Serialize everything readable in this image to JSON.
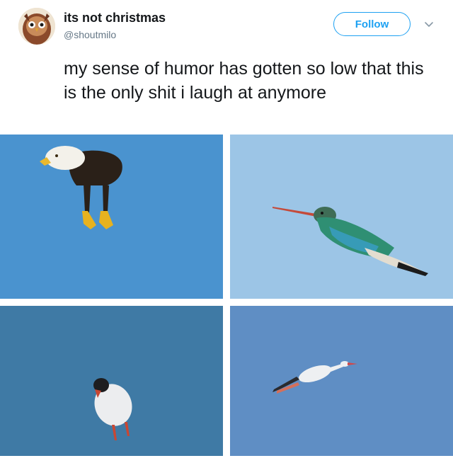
{
  "tweet": {
    "display_name": "its not christmas",
    "handle": "@shoutmilo",
    "follow_label": "Follow",
    "text": "my sense of humor has gotten so low that this is the only shit i laugh at anymore"
  },
  "media": {
    "photos": [
      {
        "icon": "eagle-photo",
        "background": "#4a93cf"
      },
      {
        "icon": "hummingbird-photo",
        "background": "#9cc5e6"
      },
      {
        "icon": "puffin-photo",
        "background": "#3f7aa5"
      },
      {
        "icon": "stork-photo",
        "background": "#5f8ec4"
      }
    ]
  },
  "colors": {
    "accent": "#1da1f2",
    "text": "#14171a",
    "secondary_text": "#657786"
  }
}
